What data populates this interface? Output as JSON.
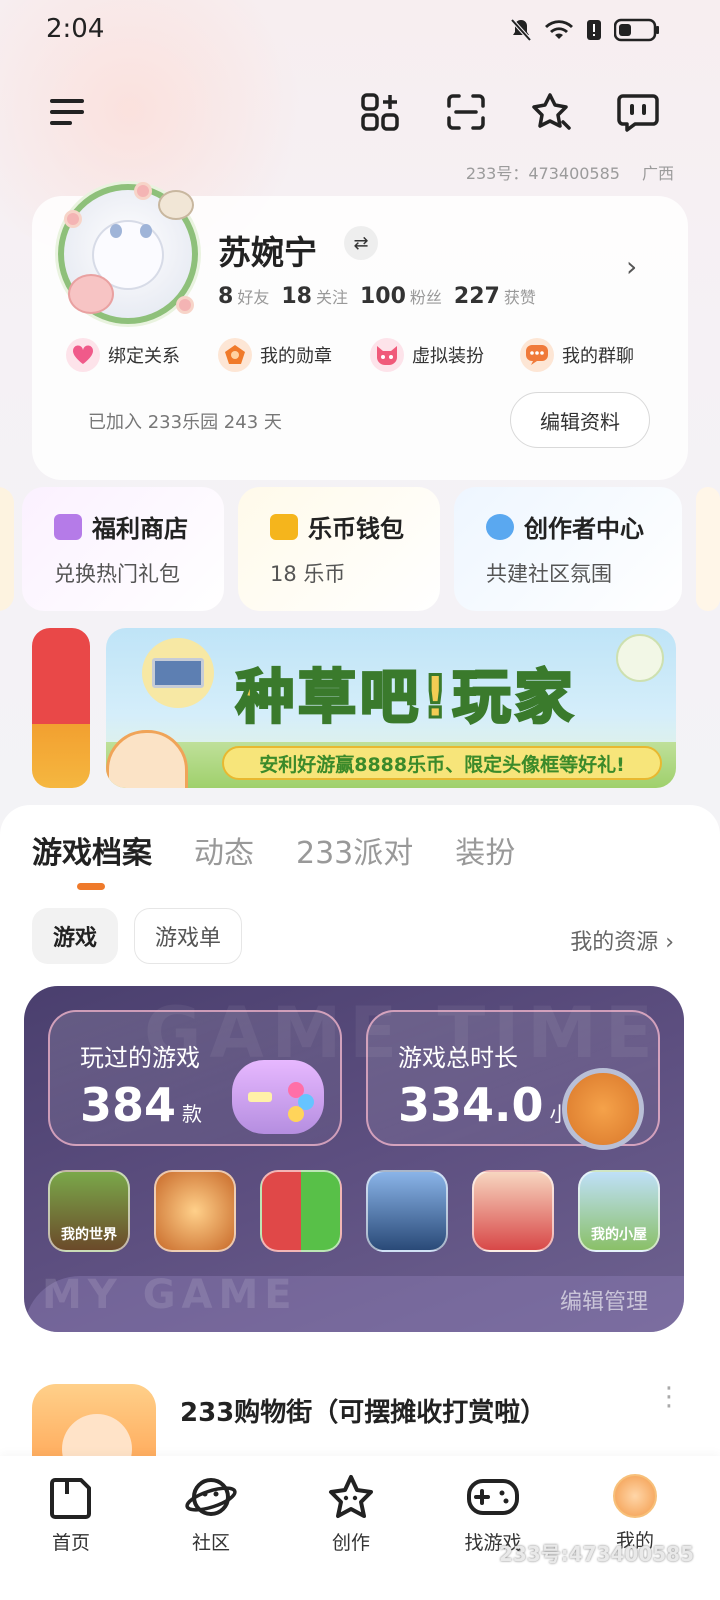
{
  "status_bar": {
    "time": "2:04"
  },
  "account": {
    "uid": "233号：473400585",
    "region": "广西"
  },
  "profile": {
    "name": "苏婉宁",
    "stats": [
      {
        "value": "8",
        "label": "好友"
      },
      {
        "value": "18",
        "label": "关注"
      },
      {
        "value": "100",
        "label": "粉丝"
      },
      {
        "value": "227",
        "label": "获赞"
      }
    ],
    "quick_actions": [
      {
        "label": "绑定关系",
        "icon": "heart-icon",
        "color": "#f05a8a"
      },
      {
        "label": "我的勋章",
        "icon": "medal-icon",
        "color": "#f07a2a"
      },
      {
        "label": "虚拟装扮",
        "icon": "cat-face-icon",
        "color": "#f05a7a"
      },
      {
        "label": "我的群聊",
        "icon": "chat-icon",
        "color": "#f07a3a"
      }
    ],
    "joined_text": "已加入 233乐园 243 天",
    "edit_button": "编辑资料"
  },
  "feature_cards": [
    {
      "title": "福利商店",
      "subtitle": "兑换热门礼包",
      "icon": "gift-icon",
      "color": "#b57be8"
    },
    {
      "title": "乐币钱包",
      "subtitle": "18 乐币",
      "icon": "wallet-icon",
      "color": "#f5b51c"
    },
    {
      "title": "创作者中心",
      "subtitle": "共建社区氛围",
      "icon": "planet-icon",
      "color": "#5aa8f0"
    }
  ],
  "banner": {
    "title": "种草吧!玩家",
    "subtitle": "安利好游赢8888乐币、限定头像框等好礼!"
  },
  "tabs": [
    "游戏档案",
    "动态",
    "233派对",
    "装扮"
  ],
  "sub_tabs": [
    "游戏",
    "游戏单"
  ],
  "my_resources": "我的资源",
  "game_stats": {
    "watermark_top": "GAME TIME",
    "watermark_bottom": "MY GAME",
    "played": {
      "label": "玩过的游戏",
      "value": "384",
      "unit": "款"
    },
    "playtime": {
      "label": "游戏总时长",
      "value": "334.0",
      "unit": "小时"
    },
    "games": [
      {
        "name": "我的世界",
        "color": "#6b8c3c"
      },
      {
        "name": "",
        "color": "#f0a040"
      },
      {
        "name": "",
        "color": "#e04848"
      },
      {
        "name": "",
        "color": "#3a6fa8"
      },
      {
        "name": "",
        "color": "#e86a5a"
      },
      {
        "name": "我的小屋",
        "color": "#8ac0e8"
      }
    ],
    "edit_manage": "编辑管理"
  },
  "list_item": {
    "title": "233购物街（可摆摊收打赏啦）"
  },
  "bottom_nav": [
    {
      "label": "首页",
      "icon": "home-icon"
    },
    {
      "label": "社区",
      "icon": "planet-face-icon"
    },
    {
      "label": "创作",
      "icon": "star-icon"
    },
    {
      "label": "找游戏",
      "icon": "gamepad-icon"
    },
    {
      "label": "我的",
      "icon": "avatar-icon"
    }
  ],
  "watermark": "233号:473400585"
}
